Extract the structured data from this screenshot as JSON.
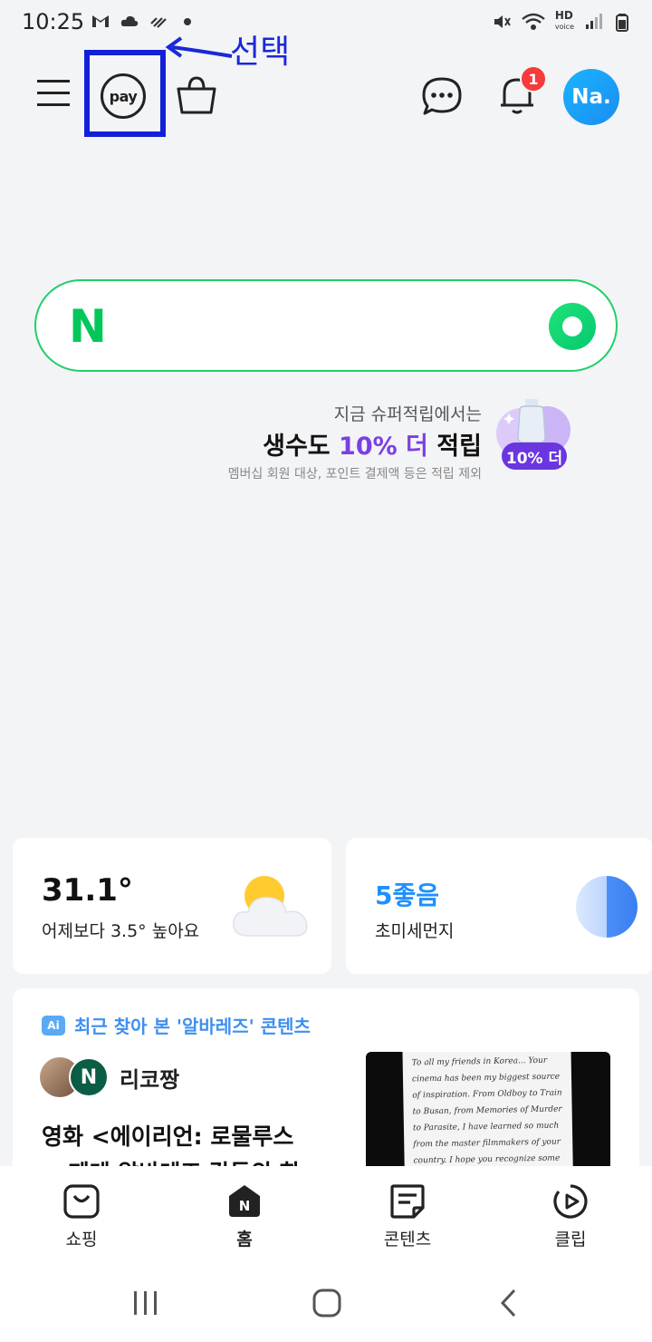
{
  "status_bar": {
    "time": "10:25",
    "icons_left": [
      "gmail-icon",
      "cloud-icon",
      "signal-activity-icon",
      "dot-icon"
    ],
    "icons_right": [
      "mute-icon",
      "wifi-icon",
      "hd-voice-icon",
      "signal-bars-icon",
      "battery-icon"
    ],
    "hd_voice": "HD"
  },
  "header": {
    "pay_label": "pay",
    "notification_count": "1",
    "avatar_initials": "Na."
  },
  "annotation": {
    "text": "선택",
    "color": "#1a28d8"
  },
  "search": {
    "logo": "N",
    "placeholder": "",
    "brand_color": "#03c75a"
  },
  "promo": {
    "subtitle": "지금 슈퍼적립에서는",
    "title_prefix": "생수도 ",
    "title_accent": "10% 더",
    "title_suffix": " 적립",
    "note": "멤버십 회원 대상, 포인트 결제액 등은 적립 제외",
    "badge": "10% 더",
    "accent_color": "#7b3fe4"
  },
  "weather": {
    "temperature": "31.1°",
    "comparison": "어제보다 3.5° 높아요",
    "icon": "partly-cloudy-icon"
  },
  "dust": {
    "value": "5좋음",
    "label": "초미세먼지",
    "color": "#1e90ff"
  },
  "content": {
    "section_badge": "Ai",
    "section_title": "최근 찾아 본 '알바레즈' 콘텐츠",
    "author_logo": "N",
    "author_name": "리코짱",
    "article_title": "영화 <에이리언: 로물루스\n> 페데 알바레즈 감독의 한",
    "thumbnail_text": "To all my friends in Korea... Your cinema has been my biggest source of inspiration. From Oldboy to Train to Busan, from Memories of Murder to Parasite, I have learned so much from the master filmmakers of your country. I hope you recognize some of those influences in Alien: Romulus! Can't wait"
  },
  "bottom_nav": {
    "items": [
      {
        "label": "쇼핑",
        "icon": "shopping-icon"
      },
      {
        "label": "홈",
        "icon": "home-icon"
      },
      {
        "label": "콘텐츠",
        "icon": "contents-icon"
      },
      {
        "label": "클립",
        "icon": "clip-icon"
      }
    ]
  },
  "system_nav": [
    "recents-icon",
    "home-icon",
    "back-icon"
  ]
}
